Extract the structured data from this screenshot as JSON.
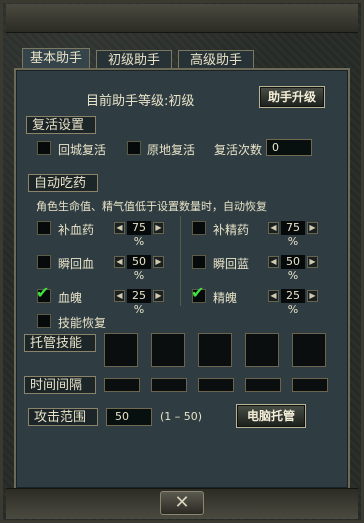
{
  "tabs": [
    {
      "label": "基本助手"
    },
    {
      "label": "初级助手"
    },
    {
      "label": "高级助手"
    }
  ],
  "header": {
    "level_text": "目前助手等级:初级",
    "upgrade_label": "助手升级"
  },
  "revive": {
    "title": "复活设置",
    "city_label": "回城复活",
    "local_label": "原地复活",
    "count_label": "复活次数",
    "count_value": "0"
  },
  "auto": {
    "title": "自动吃药",
    "desc": "角色生命值、精气值低于设置数量时，自动恢复",
    "rows": [
      {
        "left_label": "补血药",
        "left_value": "75 %",
        "right_label": "补精药",
        "right_value": "75 %"
      },
      {
        "left_label": "瞬回血",
        "left_value": "50 %",
        "right_label": "瞬回蓝",
        "right_value": "50 %"
      },
      {
        "left_label": "血魄",
        "left_value": "25 %",
        "right_label": "精魄",
        "right_value": "25 %"
      }
    ],
    "skill_label": "技能恢复"
  },
  "managed": {
    "skills_label": "托管技能",
    "interval_label": "时间间隔"
  },
  "attack": {
    "range_label": "攻击范围",
    "range_value": "50",
    "range_hint": "(1 – 50)",
    "auto_label": "电脑托管"
  },
  "arrows": {
    "left": "◀",
    "right": "▶"
  },
  "close_glyph": "✕",
  "checkmark_glyph": "✔"
}
